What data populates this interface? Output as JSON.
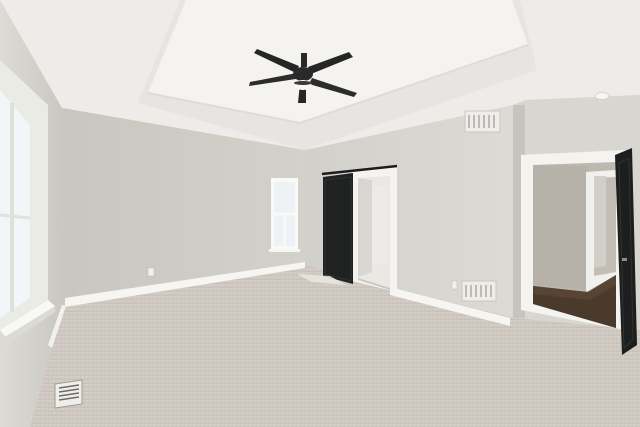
{
  "scene": {
    "kind": "photograph",
    "colors": {
      "ceiling": "#eeede9",
      "tray_ceiling": "#f4f3f0",
      "back_wall": "#cfcdc6",
      "right_wall": "#d6d4ce",
      "left_wall": "#c9c7c0",
      "carpet": "#cfc9c1",
      "baseboard": "#f7f6f3",
      "barn_door": "#1f2220",
      "fan": "#2a2a2a",
      "wood_floor": "#4a3a2c",
      "window_light": "#f3f6f8"
    },
    "elements": [
      "tray-ceiling",
      "ceiling-fan",
      "barn-door",
      "back-window",
      "large-left-window",
      "open-doorway",
      "hallway-wood-floor",
      "floor-vent",
      "wall-vents",
      "baseboards",
      "carpet"
    ]
  }
}
